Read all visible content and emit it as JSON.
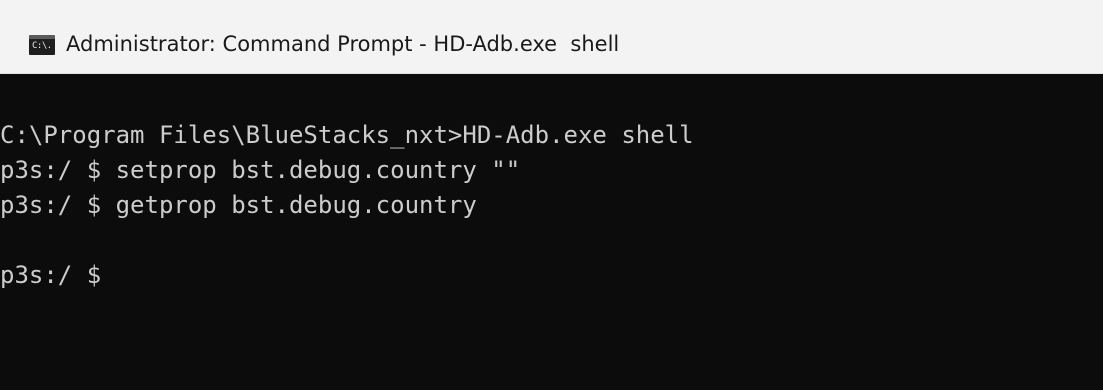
{
  "window": {
    "title": "Administrator: Command Prompt - HD-Adb.exe  shell",
    "icon": {
      "name": "command-prompt-icon",
      "label": "C:\\."
    }
  },
  "console": {
    "lines": [
      "C:\\Program Files\\BlueStacks_nxt>HD-Adb.exe shell",
      "p3s:/ $ setprop bst.debug.country \"\"",
      "p3s:/ $ getprop bst.debug.country",
      "",
      "p3s:/ $"
    ]
  },
  "colors": {
    "titlebar_bg": "#f3f3f3",
    "console_bg": "#0c0c0c",
    "console_text": "#cccccc"
  }
}
